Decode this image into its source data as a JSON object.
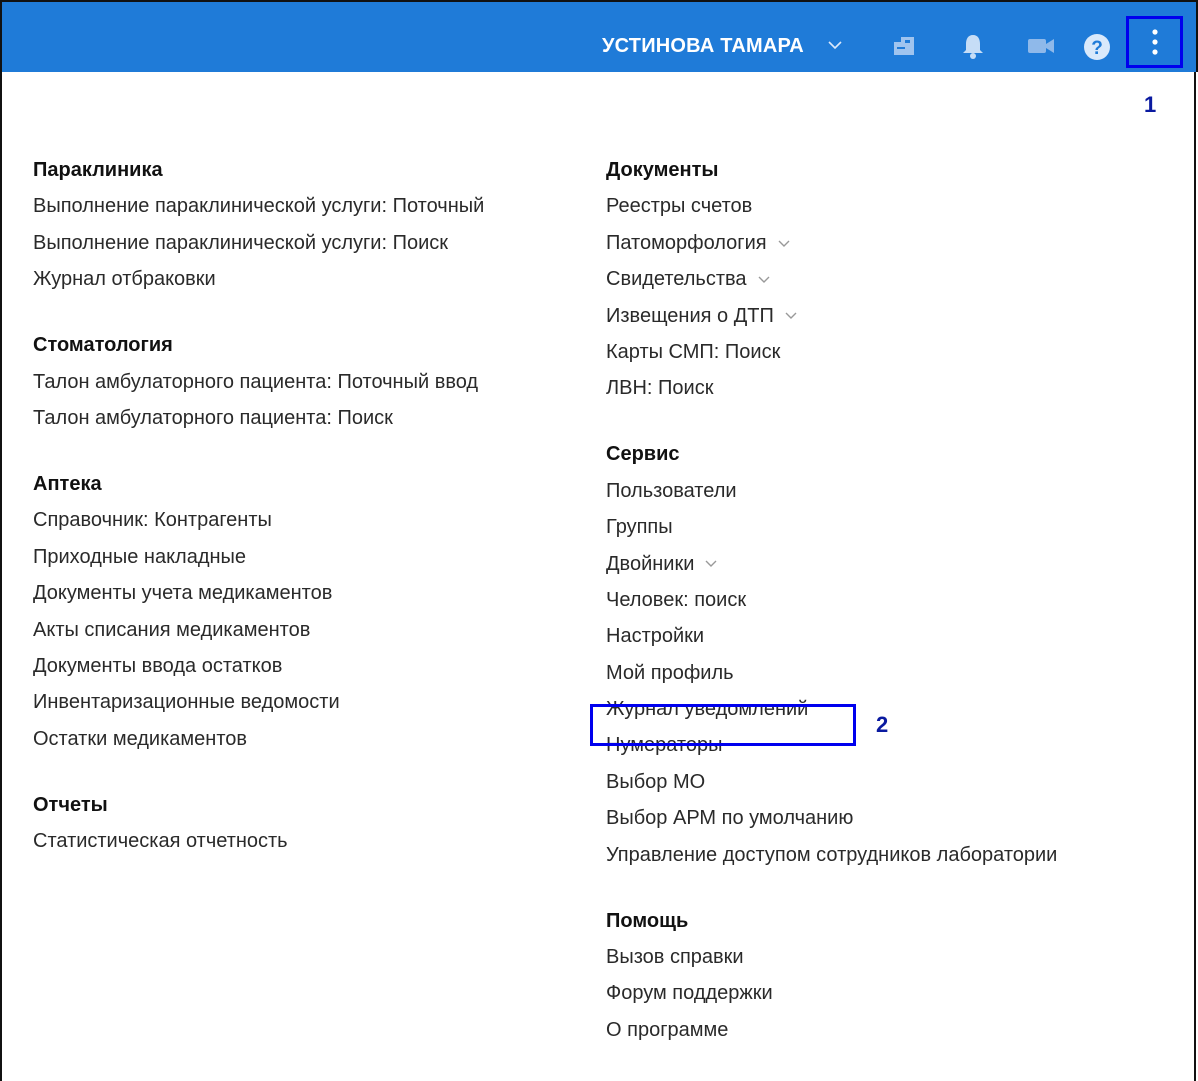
{
  "header": {
    "user_name": "УСТИНОВА ТАМАРА",
    "bg_color": "#1f7bd8",
    "icons": [
      "chevron-down-icon",
      "workplace-icon",
      "bell-icon",
      "video-icon",
      "help-icon",
      "more-vertical-icon"
    ]
  },
  "callouts": {
    "one": "1",
    "two": "2"
  },
  "left_column": {
    "paraclinic": {
      "title": "Параклиника",
      "items": [
        "Выполнение параклинической услуги: Поточный",
        "Выполнение параклинической услуги: Поиск",
        "Журнал отбраковки"
      ]
    },
    "dentistry": {
      "title": "Стоматология",
      "items": [
        "Талон амбулаторного пациента: Поточный ввод",
        "Талон амбулаторного пациента: Поиск"
      ]
    },
    "pharmacy": {
      "title": "Аптека",
      "items": [
        "Справочник: Контрагенты",
        "Приходные накладные",
        "Документы учета медикаментов",
        "Акты списания медикаментов",
        "Документы ввода остатков",
        "Инвентаризационные ведомости",
        "Остатки медикаментов"
      ]
    },
    "reports": {
      "title": "Отчеты",
      "items": [
        "Статистическая отчетность"
      ]
    }
  },
  "right_column": {
    "documents": {
      "title": "Документы",
      "items": [
        "Реестры счетов",
        "Патоморфология",
        "Свидетельства",
        "Извещения о ДТП",
        "Карты СМП: Поиск",
        "ЛВН: Поиск"
      ]
    },
    "service": {
      "title": "Сервис",
      "items": [
        "Пользователи",
        "Группы",
        "Двойники",
        "Человек: поиск",
        "Настройки",
        "Мой профиль",
        "Журнал уведомлений",
        "Нумераторы",
        "Выбор МО",
        "Выбор АРМ по умолчанию",
        "Управление доступом сотрудников лаборатории"
      ]
    },
    "help": {
      "title": "Помощь",
      "items": [
        "Вызов справки",
        "Форум поддержки",
        "О программе"
      ]
    }
  },
  "accent_color": "#0000ee"
}
